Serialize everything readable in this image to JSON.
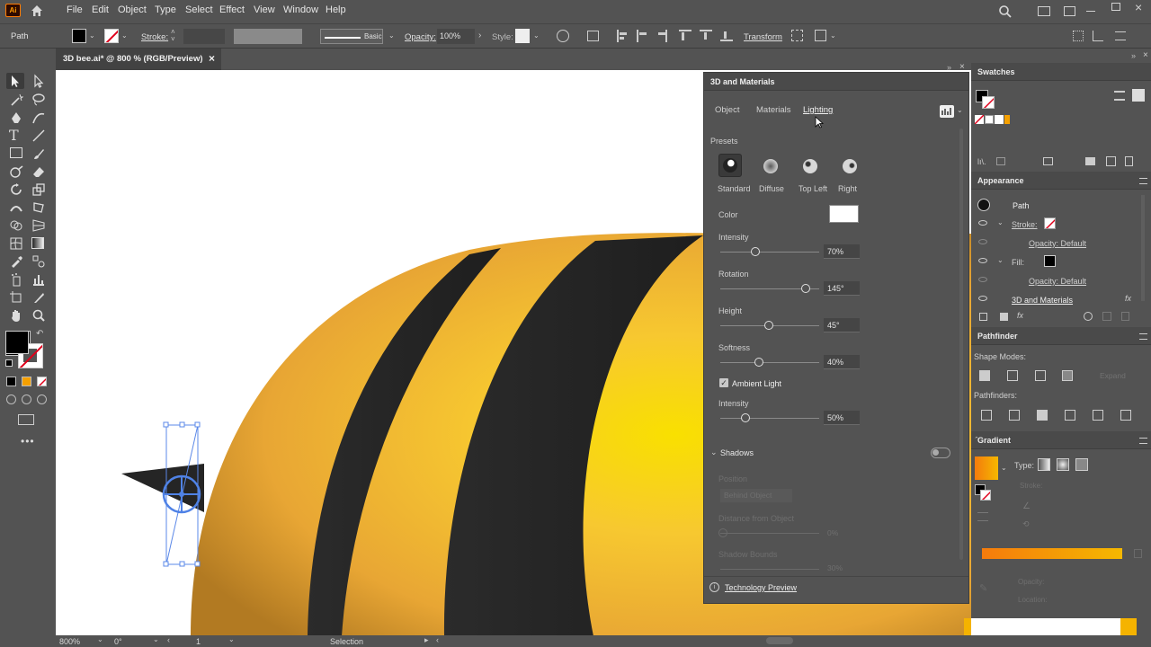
{
  "app": {
    "logo": "Ai"
  },
  "menu": [
    "File",
    "Edit",
    "Object",
    "Type",
    "Select",
    "Effect",
    "View",
    "Window",
    "Help"
  ],
  "control_bar": {
    "selection_label": "Path",
    "stroke_label": "Stroke:",
    "brush_label": "Basic",
    "opacity_label": "Opacity:",
    "opacity_value": "100%",
    "style_label": "Style:",
    "transform_label": "Transform"
  },
  "document_tab": {
    "title": "3D bee.ai* @ 800 % (RGB/Preview)",
    "close": "×"
  },
  "panel_3d": {
    "title": "3D and Materials",
    "tabs": [
      "Object",
      "Materials",
      "Lighting"
    ],
    "active_tab": "Lighting",
    "presets_label": "Presets",
    "presets": [
      "Standard",
      "Diffuse",
      "Top Left",
      "Right"
    ],
    "color_label": "Color",
    "light_color": "#ffffff",
    "intensity_label": "Intensity",
    "intensity_value": "70%",
    "rotation_label": "Rotation",
    "rotation_value": "145°",
    "height_label": "Height",
    "height_value": "45°",
    "softness_label": "Softness",
    "softness_value": "40%",
    "ambient_label": "Ambient Light",
    "ambient_checked": true,
    "ambient_intensity_label": "Intensity",
    "ambient_intensity_value": "50%",
    "shadows_label": "Shadows",
    "position_label": "Position",
    "position_value": "Behind Object",
    "distance_label": "Distance from Object",
    "distance_value": "0%",
    "bounds_label": "Shadow Bounds",
    "bounds_value": "30%",
    "tech_preview_label": "Technology Preview"
  },
  "swatches": {
    "title": "Swatches"
  },
  "appearance": {
    "title": "Appearance",
    "object_name": "Path",
    "stroke_label": "Stroke:",
    "stroke_opacity": "Opacity: Default",
    "fill_label": "Fill:",
    "fill_opacity": "Opacity: Default",
    "effect_label": "3D and Materials",
    "fx_label": "fx"
  },
  "pathfinder": {
    "title": "Pathfinder",
    "shape_modes_label": "Shape Modes:",
    "pathfinders_label": "Pathfinders:",
    "expand_label": "Expand"
  },
  "gradient": {
    "title": "Gradient",
    "type_label": "Type:",
    "stroke_label": "Stroke:",
    "opacity_label": "Opacity:",
    "location_label": "Location:",
    "start_color": "#f47b0c",
    "end_color": "#f5b800"
  },
  "status_bar": {
    "zoom": "800%",
    "rotation": "0°",
    "artboard": "1",
    "tool": "Selection"
  }
}
